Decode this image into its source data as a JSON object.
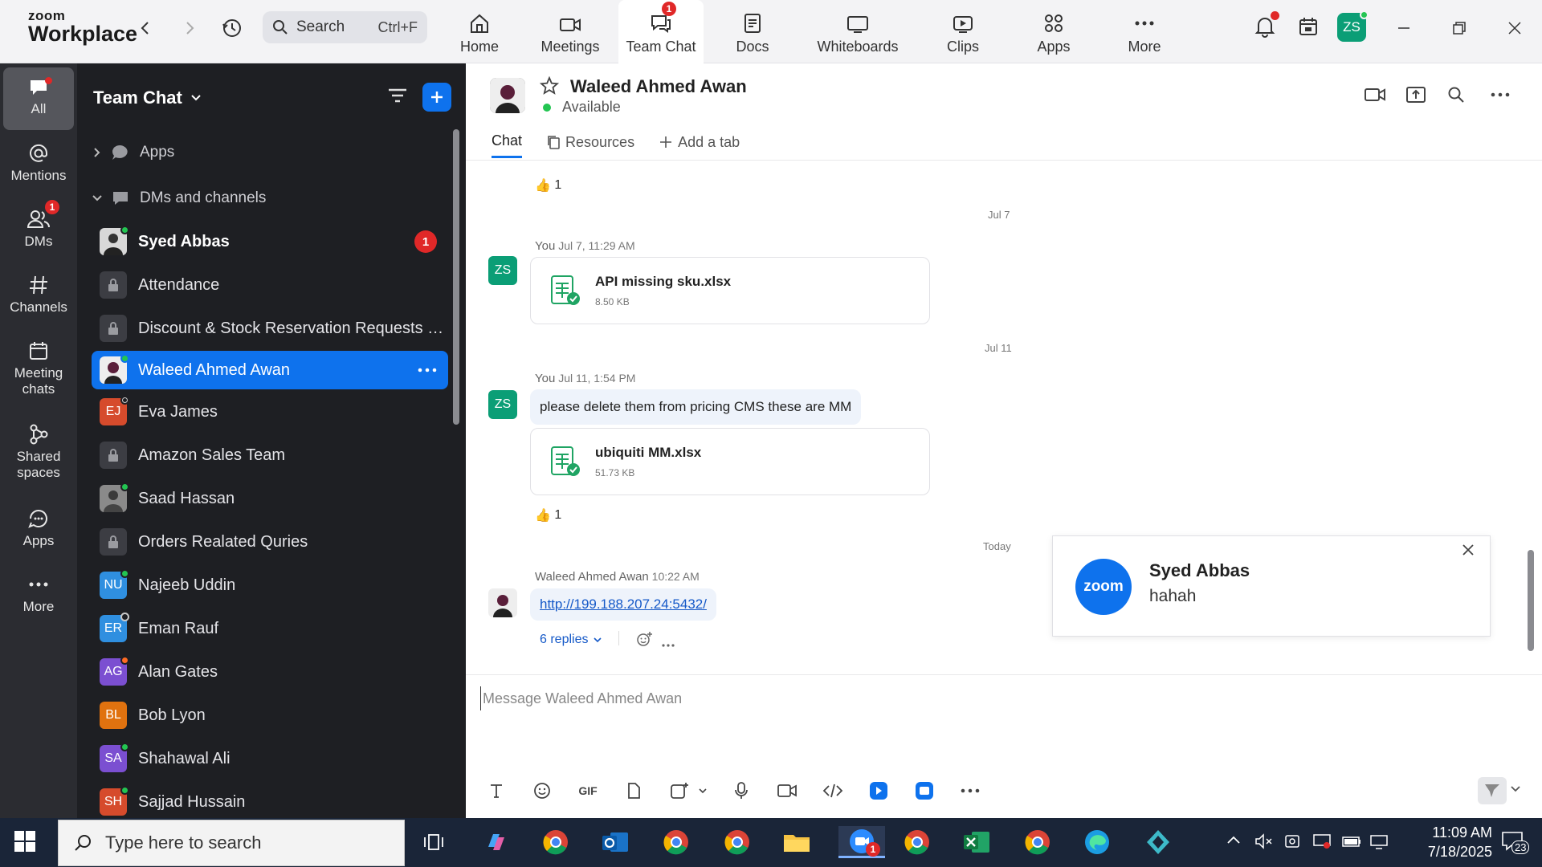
{
  "app": {
    "logo_top": "zoom",
    "logo_bottom": "Workplace",
    "search_label": "Search",
    "search_shortcut": "Ctrl+F",
    "profile_initials": "ZS"
  },
  "topnav": [
    {
      "label": "Home"
    },
    {
      "label": "Meetings"
    },
    {
      "label": "Team Chat",
      "badge": "1"
    },
    {
      "label": "Docs"
    },
    {
      "label": "Whiteboards"
    },
    {
      "label": "Clips"
    },
    {
      "label": "Apps"
    },
    {
      "label": "More"
    }
  ],
  "rail": [
    {
      "label": "All"
    },
    {
      "label": "Mentions"
    },
    {
      "label": "DMs",
      "badge": "1"
    },
    {
      "label": "Channels"
    },
    {
      "label": "Meeting chats"
    },
    {
      "label": "Shared spaces"
    },
    {
      "label": "Apps"
    },
    {
      "label": "More"
    }
  ],
  "sidebar": {
    "title": "Team Chat",
    "sections": [
      "Apps",
      "DMs and channels"
    ],
    "rows": [
      {
        "name": "Syed Abbas",
        "badge": "1"
      },
      {
        "name": "Attendance"
      },
      {
        "name": "Discount & Stock Reservation Requests O..."
      },
      {
        "name": "Waleed Ahmed Awan"
      },
      {
        "name": "Eva James",
        "initials": "EJ"
      },
      {
        "name": "Amazon Sales Team"
      },
      {
        "name": "Saad Hassan"
      },
      {
        "name": "Orders Realated Quries"
      },
      {
        "name": "Najeeb Uddin",
        "initials": "NU"
      },
      {
        "name": "Eman Rauf",
        "initials": "ER"
      },
      {
        "name": "Alan Gates",
        "initials": "AG"
      },
      {
        "name": "Bob Lyon",
        "initials": "BL"
      },
      {
        "name": "Shahawal Ali",
        "initials": "SA"
      },
      {
        "name": "Sajjad Hussain",
        "initials": "SH"
      }
    ]
  },
  "chat": {
    "contact_name": "Waleed Ahmed Awan",
    "contact_status": "Available",
    "tabs": [
      "Chat",
      "Resources",
      "Add a tab"
    ],
    "messages": {
      "top_reaction": "1",
      "date1": "Jul 7",
      "m1_sender": "You",
      "m1_time": "Jul 7, 11:29 AM",
      "m1_file": "API missing sku.xlsx",
      "m1_size": "8.50 KB",
      "date2": "Jul 11",
      "m2_sender": "You",
      "m2_time": "Jul 11, 1:54 PM",
      "m2_text": "please delete them from pricing CMS these are MM",
      "m2_file": "ubiquiti MM.xlsx",
      "m2_size": "51.73 KB",
      "m2_reaction": "1",
      "date3": "Today",
      "m3_sender": "Waleed Ahmed Awan",
      "m3_time": "10:22 AM",
      "m3_link": "http://199.188.207.24:5432/",
      "m3_replies": "6 replies",
      "sender_initials": "ZS"
    },
    "composer_placeholder": "Message Waleed Ahmed Awan"
  },
  "notification": {
    "brand": "zoom",
    "title": "Syed Abbas",
    "body": "hahah"
  },
  "taskbar": {
    "search_placeholder": "Type here to search",
    "time": "11:09 AM",
    "date": "7/18/2025",
    "notif_count": "23",
    "zoom_badge": "1"
  },
  "colors": {
    "accent": "#0e72ed",
    "badge": "#e02828",
    "online": "#23c552",
    "sidebar_bg": "#1e1f23",
    "rail_bg": "#2b2c31"
  }
}
